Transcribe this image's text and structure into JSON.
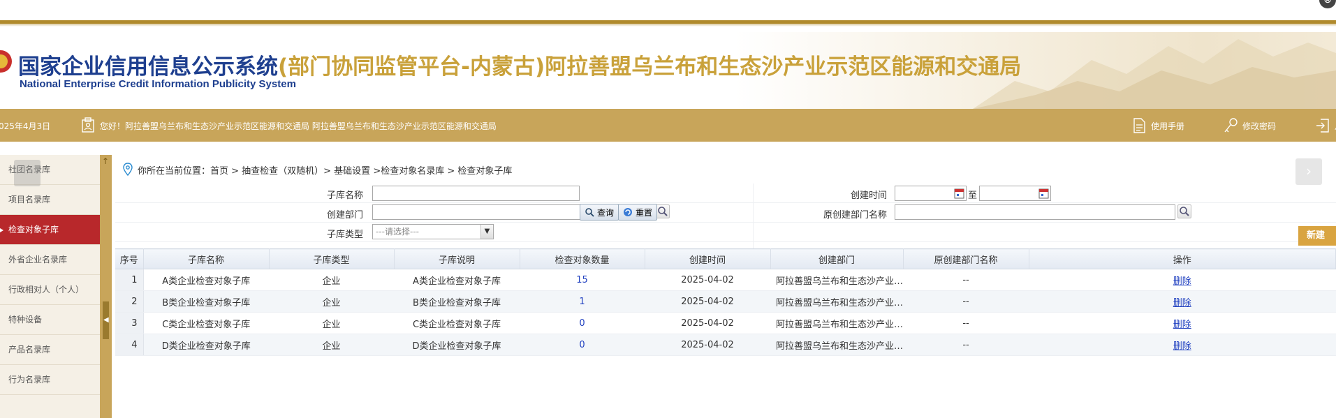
{
  "window": {
    "close_glyph": "⊗"
  },
  "header": {
    "title_main": "国家企业信用信息公示系统",
    "title_sub": "(部门协同监管平台-内蒙古)阿拉善盟乌兰布和生态沙产业示范区能源和交通局",
    "title_en": "National Enterprise Credit Information Publicity System"
  },
  "navbar": {
    "date": "025年4月3日",
    "greeting": "您好！阿拉善盟乌兰布和生态沙产业示范区能源和交通局 阿拉善盟乌兰布和生态沙产业示范区能源和交通局",
    "manual": "使用手册",
    "change_password": "修改密码",
    "logout_partial": "月"
  },
  "sidebar": {
    "items": [
      {
        "label": "社团名录库",
        "active": false
      },
      {
        "label": "项目名录库",
        "active": false
      },
      {
        "label": "检查对象子库",
        "active": true
      },
      {
        "label": "外省企业名录库",
        "active": false
      },
      {
        "label": "行政相对人（个人）",
        "active": false
      },
      {
        "label": "特种设备",
        "active": false
      },
      {
        "label": "产品名录库",
        "active": false
      },
      {
        "label": "行为名录库",
        "active": false
      }
    ]
  },
  "breadcrumb": "你所在当前位置：首页 > 抽查检查（双随机）> 基础设置 >检查对象名录库 > 检查对象子库",
  "form": {
    "sub_name_label": "子库名称",
    "create_time_label": "创建时间",
    "to_label": "至",
    "create_dept_label": "创建部门",
    "orig_dept_label": "原创建部门名称",
    "sub_type_label": "子库类型",
    "sub_type_value": "---请选择---",
    "query_label": "查询",
    "reset_label": "重置"
  },
  "new_button": "新建",
  "table": {
    "headers": [
      "序号",
      "子库名称",
      "子库类型",
      "子库说明",
      "检查对象数量",
      "创建时间",
      "创建部门",
      "原创建部门名称",
      "操作"
    ],
    "rows": [
      {
        "no": "1",
        "name": "A类企业检查对象子库",
        "type": "企业",
        "desc": "A类企业检查对象子库",
        "count": "15",
        "time": "2025-04-02",
        "dept": "阿拉善盟乌兰布和生态沙产业…",
        "orig": "--",
        "op": "删除"
      },
      {
        "no": "2",
        "name": "B类企业检查对象子库",
        "type": "企业",
        "desc": "B类企业检查对象子库",
        "count": "1",
        "time": "2025-04-02",
        "dept": "阿拉善盟乌兰布和生态沙产业…",
        "orig": "--",
        "op": "删除"
      },
      {
        "no": "3",
        "name": "C类企业检查对象子库",
        "type": "企业",
        "desc": "C类企业检查对象子库",
        "count": "0",
        "time": "2025-04-02",
        "dept": "阿拉善盟乌兰布和生态沙产业…",
        "orig": "--",
        "op": "删除"
      },
      {
        "no": "4",
        "name": "D类企业检查对象子库",
        "type": "企业",
        "desc": "D类企业检查对象子库",
        "count": "0",
        "time": "2025-04-02",
        "dept": "阿拉善盟乌兰布和生态沙产业…",
        "orig": "--",
        "op": "删除"
      }
    ]
  },
  "colors": {
    "gold": "#c8a55a",
    "navy": "#1e3f8f",
    "active_red": "#b8282b",
    "link_blue": "#2040c0"
  }
}
